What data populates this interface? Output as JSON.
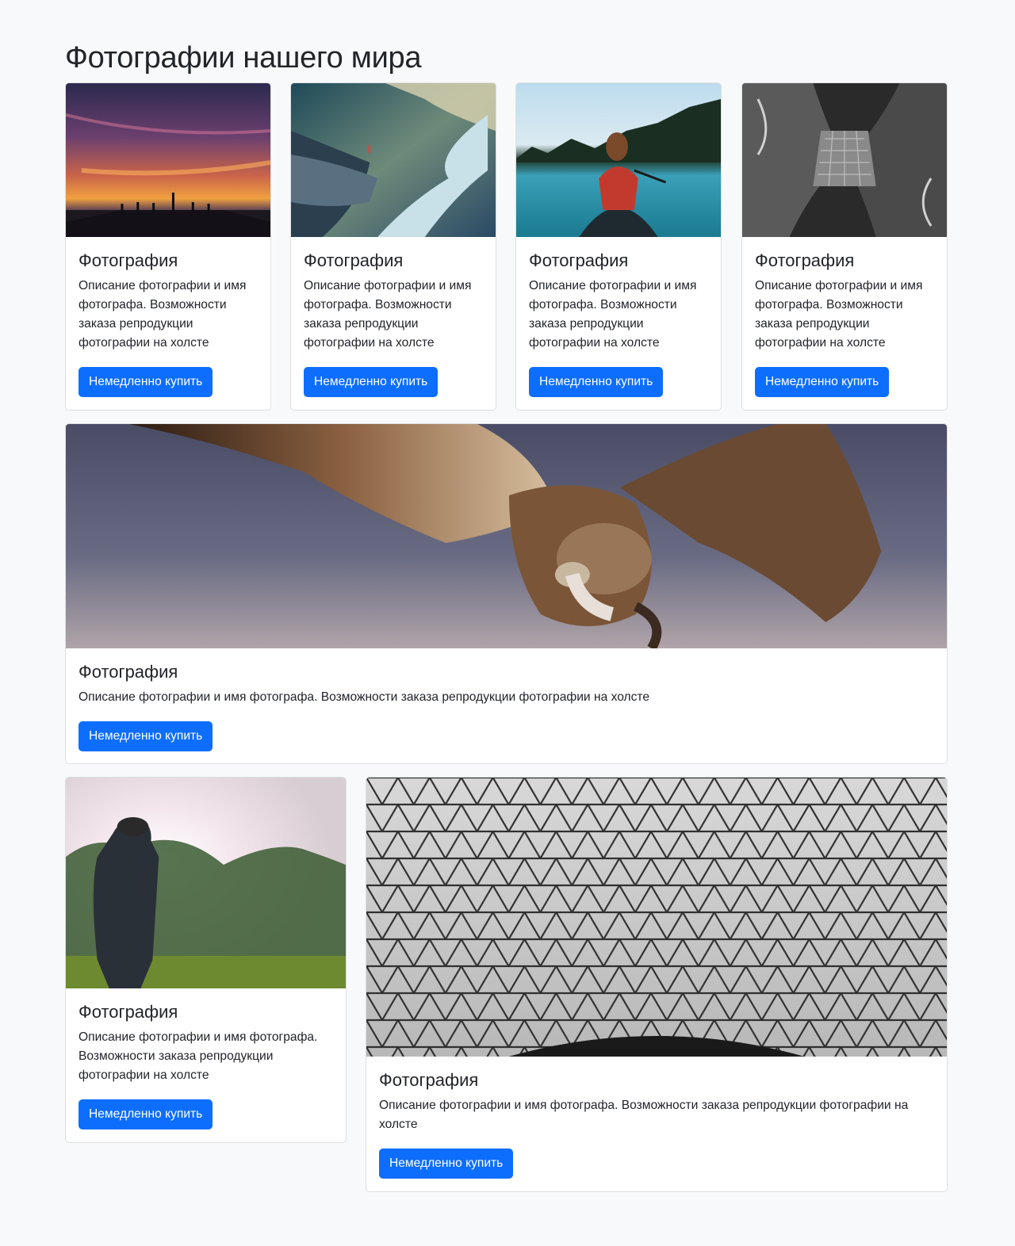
{
  "page": {
    "heading": "Фотографии нашего мира"
  },
  "cards": [
    {
      "title": "Фотография",
      "text": "Описание фотографии и имя фотографа. Возможности заказа репродукции фотографии на холсте",
      "button": "Немедленно купить",
      "image": "sunset-pier"
    },
    {
      "title": "Фотография",
      "text": "Описание фотографии и имя фотографа. Возможности заказа репродукции фотографии на холсте",
      "button": "Немедленно купить",
      "image": "mountain-fjord"
    },
    {
      "title": "Фотография",
      "text": "Описание фотографии и имя фотографа. Возможности заказа репродукции фотографии на холсте",
      "button": "Немедленно купить",
      "image": "girl-in-canoe"
    },
    {
      "title": "Фотография",
      "text": "Описание фотографии и имя фотографа. Возможности заказа репродукции фотографии на холсте",
      "button": "Немедленно купить",
      "image": "arch-from-below"
    },
    {
      "title": "Фотография",
      "text": "Описание фотографии и имя фотографа. Возможности заказа репродукции фотографии на холсте",
      "button": "Немедленно купить",
      "image": "vulture-flying"
    },
    {
      "title": "Фотография",
      "text": "Описание фотографии и имя фотографа. Возможности заказа репродукции фотографии на холсте",
      "button": "Немедленно купить",
      "image": "man-in-sunlight"
    },
    {
      "title": "Фотография",
      "text": "Описание фотографии и имя фотографа. Возможности заказа репродукции фотографии на холсте",
      "button": "Немедленно купить",
      "image": "glass-roof"
    }
  ],
  "colors": {
    "page_bg": "#f8f9fa",
    "button_bg": "#0d6efd",
    "button_text": "#ffffff",
    "card_border": "#dcdfe3"
  }
}
